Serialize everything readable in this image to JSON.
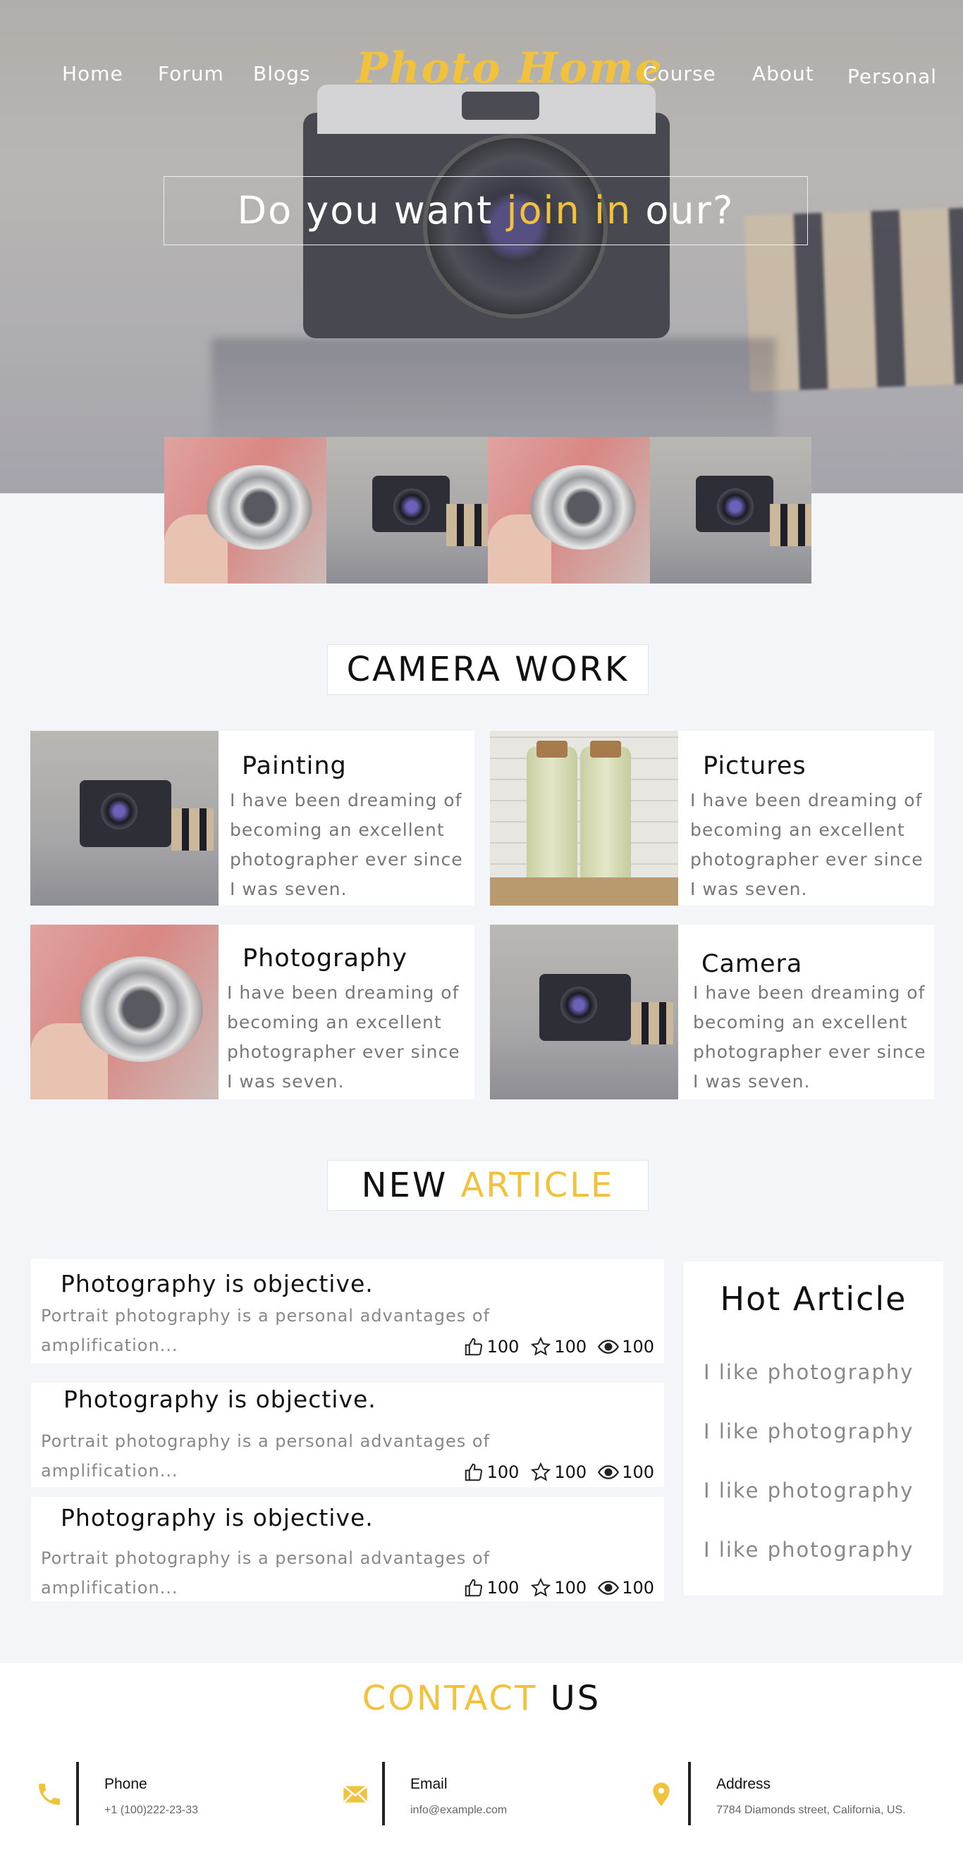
{
  "nav": {
    "home": "Home",
    "forum": "Forum",
    "blogs": "Blogs",
    "logo": "Photo Home",
    "course": "Course",
    "about": "About",
    "personal": "Personal"
  },
  "hero": {
    "part1": "Do you want ",
    "highlight": "join in",
    "part2": " our?"
  },
  "camera_work": {
    "title": "CAMERA WORK",
    "cards": [
      {
        "title": "Painting",
        "l1": "I have been dreaming of",
        "l2": "becoming an excellent",
        "l3": "photographer ever since",
        "l4": " I was seven."
      },
      {
        "title": "Pictures",
        "l1": "I have been dreaming of",
        "l2": "becoming an excellent",
        "l3": "photographer ever since",
        "l4": "I was seven."
      },
      {
        "title": "Photography",
        "l1": "I have been dreaming of",
        "l2": "becoming an excellent",
        "l3": "photographer ever since",
        "l4": " I was seven."
      },
      {
        "title": "Camera",
        "l1": "I have been dreaming of",
        "l2": "becoming an excellent",
        "l3": "photographer ever since",
        "l4": " I was seven."
      }
    ]
  },
  "new_article": {
    "title_a": "NEW ",
    "title_b": "ARTICLE",
    "articles": [
      {
        "title": "Photography is objective.",
        "l1": "Portrait photography is a personal advantages of",
        "l2": "amplification...",
        "likes": "100",
        "stars": "100",
        "views": "100"
      },
      {
        "title": "Photography is objective.",
        "l1": "Portrait photography is a personal advantages of",
        "l2": "amplification...",
        "likes": "100",
        "stars": "100",
        "views": "100"
      },
      {
        "title": "Photography is objective.",
        "l1": "Portrait photography is a personal advantages of",
        "l2": "amplification...",
        "likes": "100",
        "stars": "100",
        "views": "100"
      }
    ],
    "hot": {
      "title": "Hot Article",
      "items": [
        "I like photography",
        "I like photography",
        "I like photography",
        "I like photography"
      ]
    }
  },
  "contact": {
    "title_a": "CONTACT",
    "title_b": " US",
    "phone_label": "Phone",
    "phone_value": "+1 (100)222-23-33",
    "email_label": "Email",
    "email_value": "info@example.com",
    "address_label": "Address",
    "address_value": "7784 Diamonds street, California, US."
  },
  "colors": {
    "accent": "#f2c23c",
    "page_bg": "#f4f5f9",
    "card_bg": "#ffffff",
    "text_muted": "#888888"
  },
  "icons": [
    "thumb-up-icon",
    "star-icon",
    "eye-icon",
    "phone-icon",
    "envelope-icon",
    "location-pin-icon"
  ]
}
